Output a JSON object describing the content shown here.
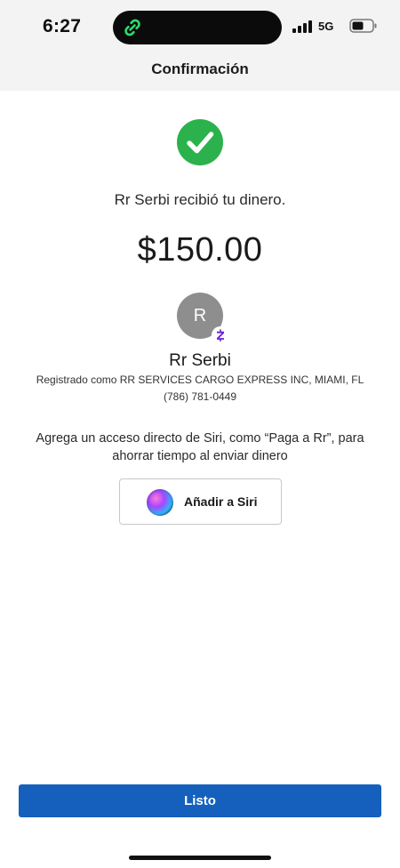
{
  "status_bar": {
    "time": "6:27",
    "network": "5G",
    "app_icon": "link-icon",
    "signal_icon": "cellular-signal-icon",
    "battery_icon": "battery-icon"
  },
  "header": {
    "title": "Confirmación"
  },
  "confirmation": {
    "status_icon": "check-circle-icon",
    "success_color": "#2bb24c",
    "message": "Rr Serbi recibió tu dinero.",
    "amount": "$150.00"
  },
  "recipient": {
    "avatar_initial": "R",
    "badge_icon": "zelle-icon",
    "badge_color": "#6d1ed4",
    "name": "Rr Serbi",
    "registered_as": "Registrado como RR SERVICES CARGO EXPRESS INC, MIAMI, FL",
    "phone": "(786) 781-0449"
  },
  "siri": {
    "prompt": "Agrega un acceso directo de Siri, como “Paga a Rr”, para ahorrar tiempo al enviar dinero",
    "button_label": "Añadir a Siri",
    "button_icon": "siri-icon"
  },
  "actions": {
    "done_label": "Listo",
    "accent_color": "#1560bd"
  }
}
